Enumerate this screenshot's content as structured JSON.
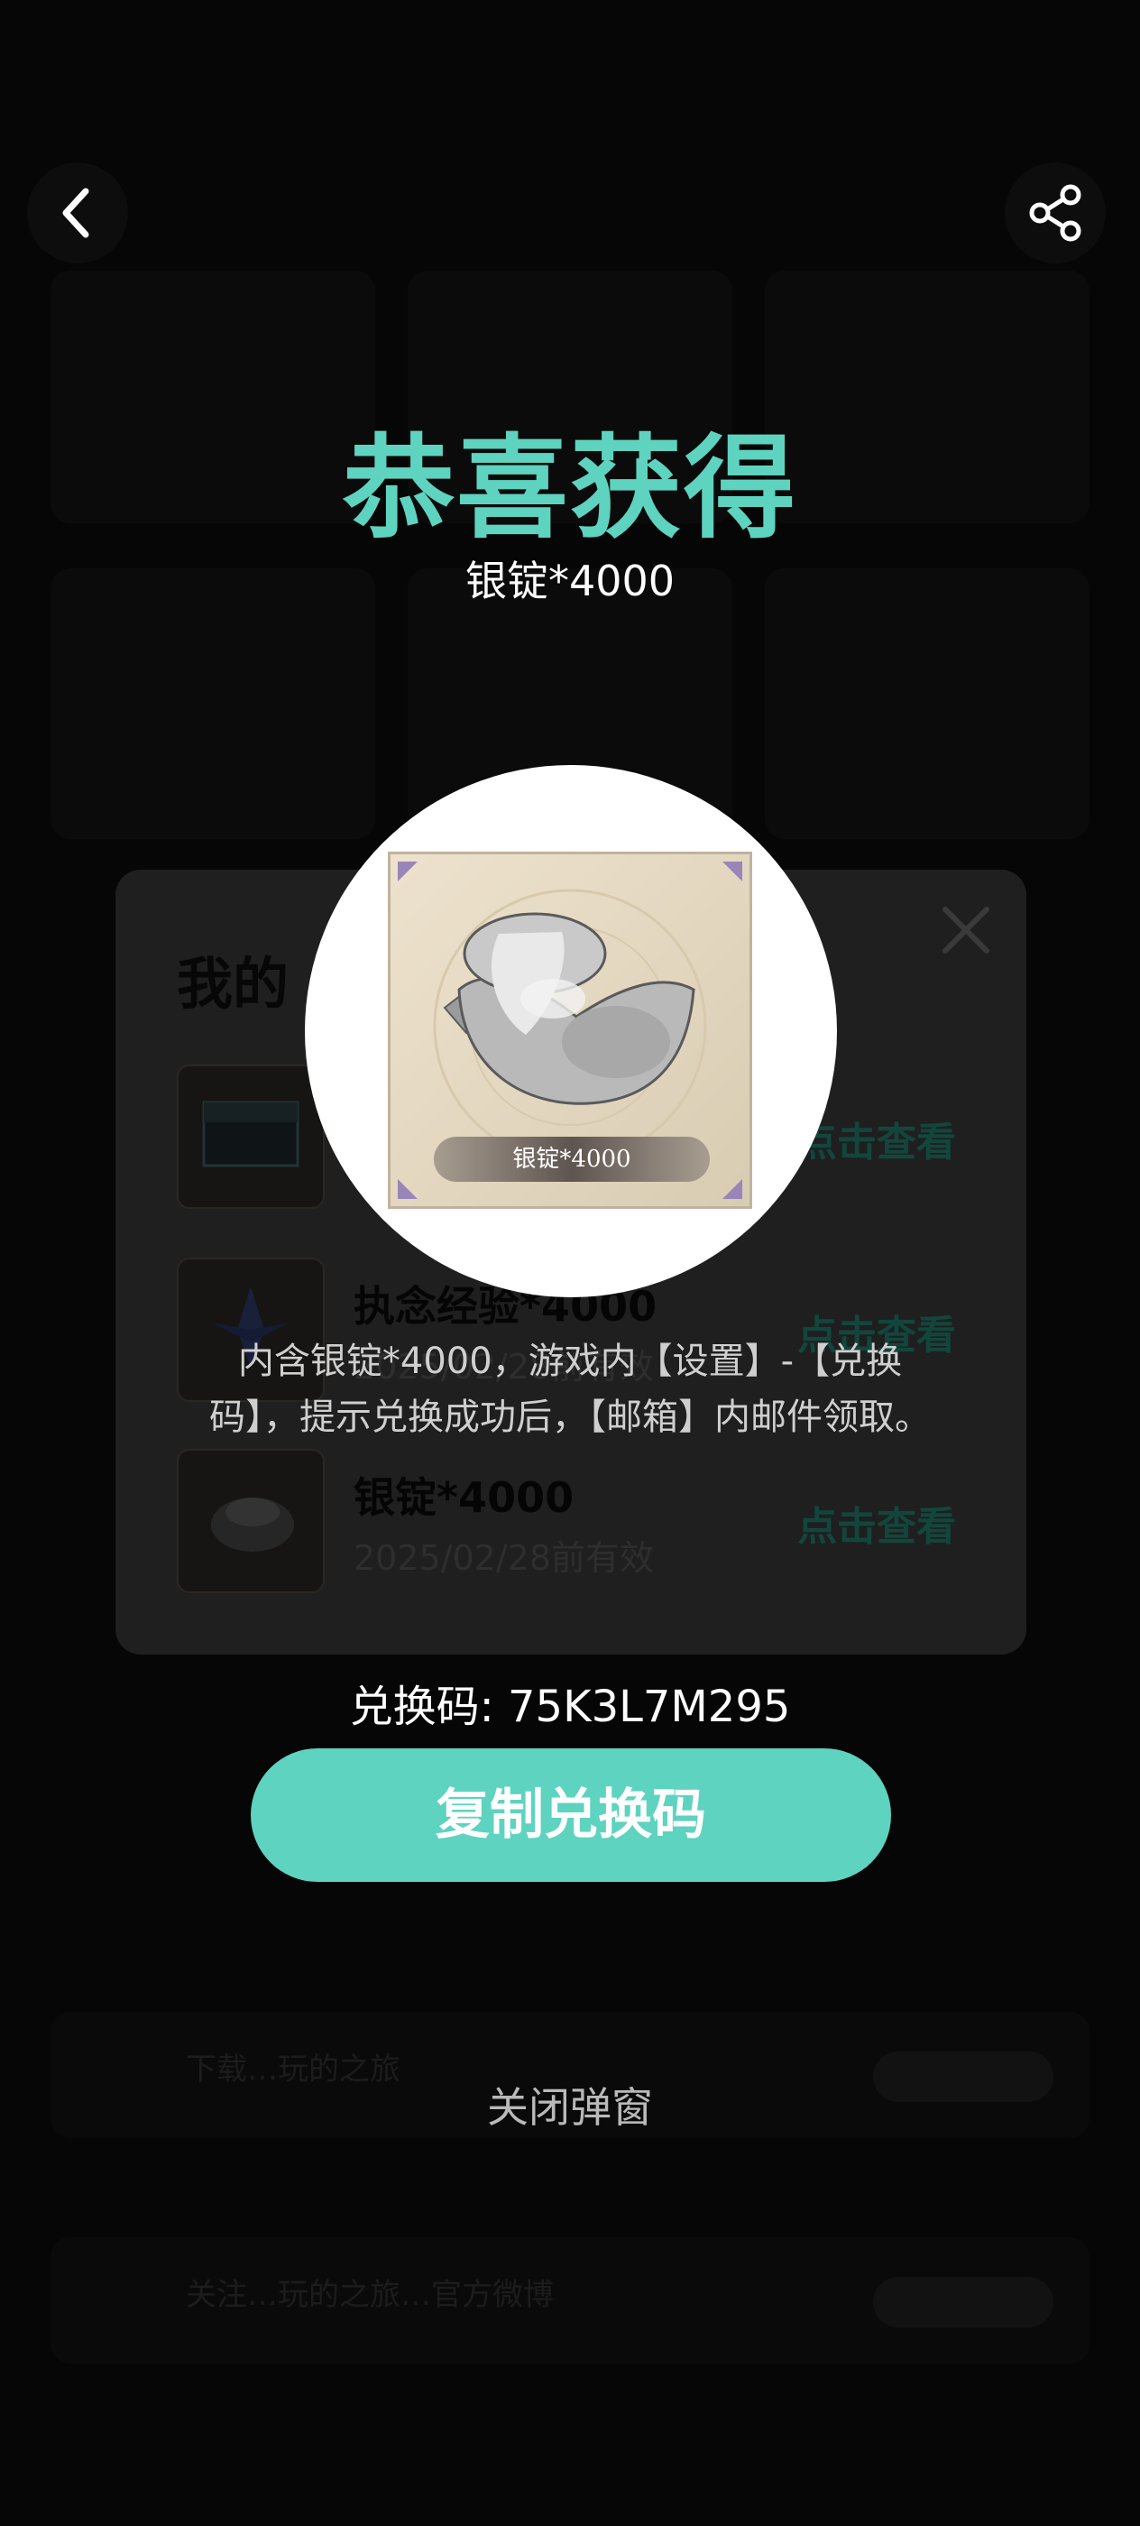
{
  "popup": {
    "title": "恭喜获得",
    "subtitle": "银锭*4000",
    "prize_label": "银锭*4000",
    "description": "内含银锭*4000，游戏内【设置】-【兑换码】，提示兑换成功后，【邮箱】内邮件领取。",
    "code_text": "兑换码: 75K3L7M295",
    "copy_button": "复制兑换码",
    "close_text": "关闭弹窗"
  },
  "nav": {
    "back_icon": "chevron-left-icon",
    "share_icon": "share-icon"
  },
  "card": {
    "title": "我的",
    "items": [
      {
        "name": "",
        "date": "",
        "link": "点击查看"
      },
      {
        "name": "执念经验*4000",
        "date": "2025/02/28前有效",
        "link": "点击查看"
      },
      {
        "name": "银锭*4000",
        "date": "2025/02/28前有效",
        "link": "点击查看"
      }
    ]
  },
  "background": {
    "rows": [
      {
        "text": "下载…玩的之旅"
      },
      {
        "text": "关注…玩的之旅…官方微博"
      }
    ]
  },
  "colors": {
    "accent": "#5ed3bf",
    "background": "#050505",
    "card": "#1f1f1f"
  }
}
